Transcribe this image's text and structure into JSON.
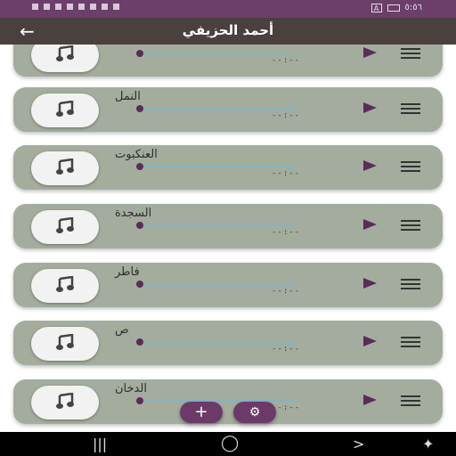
{
  "status_bar": {
    "time": "٥:٥٦",
    "notification_icons": [
      "square-icon",
      "square-icon",
      "image-icon",
      "signal-icon",
      "bars-icon",
      "wifi-icon",
      "square-icon",
      "square-icon"
    ],
    "indicator": "A"
  },
  "app_bar": {
    "title": "أحمد الحزيفي",
    "back_icon": "arrow-left-icon"
  },
  "surahs": [
    {
      "name": "",
      "time": "--:--"
    },
    {
      "name": "النمل",
      "time": "--:--"
    },
    {
      "name": "العنكبوت",
      "time": "--:--"
    },
    {
      "name": "السجدة",
      "time": "--:--"
    },
    {
      "name": "فاطر",
      "time": "--:--"
    },
    {
      "name": "ص",
      "time": "--:--"
    },
    {
      "name": "الدخان",
      "time": "--:--"
    }
  ],
  "fabs": {
    "add_label": "+",
    "settings_label": "⚙"
  },
  "nav_bar": {
    "recents": "|||",
    "home": "◯",
    "back": ">",
    "accessibility": "✦"
  },
  "colors": {
    "status_bar": "#6b3f69",
    "app_bar": "#4a403e",
    "card": "#a4ad9d",
    "accent": "#5a2c59",
    "track": "#86b3bf"
  }
}
